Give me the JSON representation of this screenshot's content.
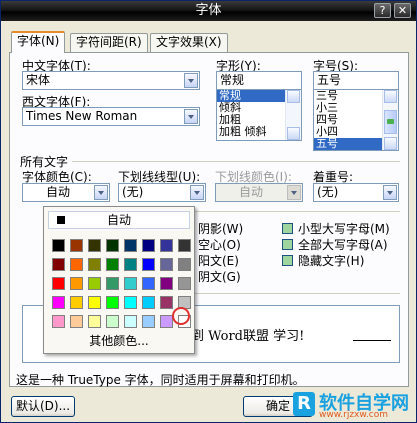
{
  "window": {
    "title": "字体",
    "help": "?",
    "close": "✕"
  },
  "tabs": [
    {
      "label": "字体(N)"
    },
    {
      "label": "字符间距(R)"
    },
    {
      "label": "文字效果(X)"
    }
  ],
  "fields": {
    "chinese_font_label": "中文字体(T):",
    "chinese_font_value": "宋体",
    "western_font_label": "西文字体(F):",
    "western_font_value": "Times New Roman",
    "style_label": "字形(Y):",
    "style_value": "常规",
    "style_options": [
      "常规",
      "倾斜",
      "加粗",
      "加粗 倾斜"
    ],
    "size_label": "字号(S):",
    "size_value": "五号",
    "size_options": [
      "三号",
      "小三",
      "四号",
      "小四",
      "五号"
    ]
  },
  "all_text": {
    "section_label": "所有文字",
    "font_color_label": "字体颜色(C):",
    "font_color_value": "自动",
    "underline_label": "下划线线型(U):",
    "underline_value": "(无)",
    "underline_color_label": "下划线颜色(I):",
    "underline_color_value": "自动",
    "emphasis_label": "着重号:",
    "emphasis_value": "(无)"
  },
  "effects_left": [
    "阴影(W)",
    "空心(O)",
    "阳文(E)",
    "阴文(G)"
  ],
  "effects_right": [
    "小型大写字母(M)",
    "全部大写字母(A)",
    "隐藏文字(H)"
  ],
  "preview_text": "到 Word联盟 学习!",
  "note": "这是一种 TrueType 字体，同时适用于屏幕和打印机。",
  "buttons": {
    "default": "默认(D)...",
    "ok": "确定"
  },
  "color_popup": {
    "auto_label": "自动",
    "more_label": "其他颜色...",
    "rows": [
      [
        "#000000",
        "#993300",
        "#333300",
        "#003300",
        "#003366",
        "#000080",
        "#333399",
        "#333333"
      ],
      [
        "#800000",
        "#ff6600",
        "#808000",
        "#008000",
        "#008080",
        "#0000ff",
        "#666699",
        "#808080"
      ],
      [
        "#ff0000",
        "#ff9900",
        "#99cc00",
        "#339966",
        "#33cccc",
        "#3366ff",
        "#800080",
        "#969696"
      ],
      [
        "#ff00ff",
        "#ffcc00",
        "#ffff00",
        "#00ff00",
        "#00ffff",
        "#00ccff",
        "#993366",
        "#c0c0c0"
      ],
      [
        "#ff99cc",
        "#ffcc99",
        "#ffff99",
        "#ccffcc",
        "#ccffff",
        "#99ccff",
        "#cc99ff",
        "#ffffff"
      ]
    ]
  },
  "watermark": {
    "brand": "软件自学网",
    "url": "www.rjzxw.com"
  }
}
